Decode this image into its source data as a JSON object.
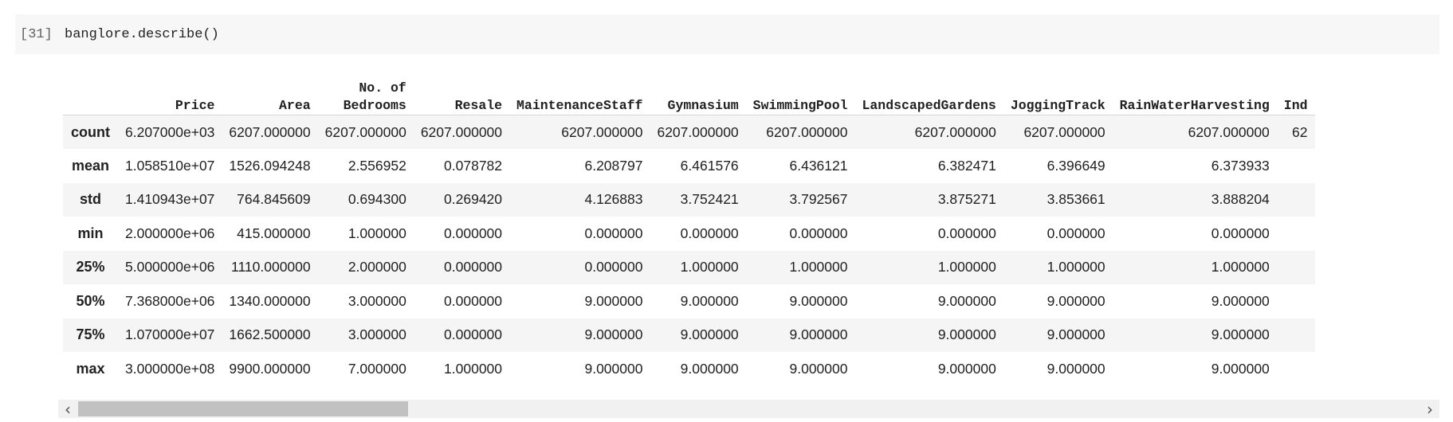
{
  "cell": {
    "execution_count": "[31]",
    "code": "banglore.describe()"
  },
  "table": {
    "columns": [
      "Price",
      "Area",
      "No. of\nBedrooms",
      "Resale",
      "MaintenanceStaff",
      "Gymnasium",
      "SwimmingPool",
      "LandscapedGardens",
      "JoggingTrack",
      "RainWaterHarvesting",
      "Ind"
    ],
    "rows": [
      {
        "label": "count",
        "values": [
          "6.207000e+03",
          "6207.000000",
          "6207.000000",
          "6207.000000",
          "6207.000000",
          "6207.000000",
          "6207.000000",
          "6207.000000",
          "6207.000000",
          "6207.000000",
          "62"
        ]
      },
      {
        "label": "mean",
        "values": [
          "1.058510e+07",
          "1526.094248",
          "2.556952",
          "0.078782",
          "6.208797",
          "6.461576",
          "6.436121",
          "6.382471",
          "6.396649",
          "6.373933",
          ""
        ]
      },
      {
        "label": "std",
        "values": [
          "1.410943e+07",
          "764.845609",
          "0.694300",
          "0.269420",
          "4.126883",
          "3.752421",
          "3.792567",
          "3.875271",
          "3.853661",
          "3.888204",
          ""
        ]
      },
      {
        "label": "min",
        "values": [
          "2.000000e+06",
          "415.000000",
          "1.000000",
          "0.000000",
          "0.000000",
          "0.000000",
          "0.000000",
          "0.000000",
          "0.000000",
          "0.000000",
          ""
        ]
      },
      {
        "label": "25%",
        "values": [
          "5.000000e+06",
          "1110.000000",
          "2.000000",
          "0.000000",
          "0.000000",
          "1.000000",
          "1.000000",
          "1.000000",
          "1.000000",
          "1.000000",
          ""
        ]
      },
      {
        "label": "50%",
        "values": [
          "7.368000e+06",
          "1340.000000",
          "3.000000",
          "0.000000",
          "9.000000",
          "9.000000",
          "9.000000",
          "9.000000",
          "9.000000",
          "9.000000",
          ""
        ]
      },
      {
        "label": "75%",
        "values": [
          "1.070000e+07",
          "1662.500000",
          "3.000000",
          "0.000000",
          "9.000000",
          "9.000000",
          "9.000000",
          "9.000000",
          "9.000000",
          "9.000000",
          ""
        ]
      },
      {
        "label": "max",
        "values": [
          "3.000000e+08",
          "9900.000000",
          "7.000000",
          "1.000000",
          "9.000000",
          "9.000000",
          "9.000000",
          "9.000000",
          "9.000000",
          "9.000000",
          ""
        ]
      }
    ]
  },
  "scrollbar": {
    "left_icon": "chevron-left-icon",
    "right_icon": "chevron-right-icon",
    "left_glyph": "‹",
    "right_glyph": "›"
  }
}
